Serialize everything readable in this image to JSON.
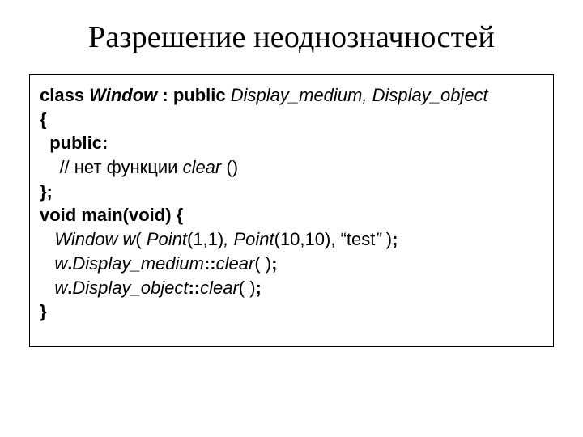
{
  "title": "Разрешение неоднозначностей",
  "code": {
    "l1a": "class ",
    "l1b": "Window",
    "l1c": " : public ",
    "l1d": "Display_medium, Display_object",
    "l2": "{",
    "l3": "  public:",
    "l4a": "    // нет функции ",
    "l4b": "clear",
    "l4c": " ()",
    "l5": "};",
    "l6": "void main(void) {",
    "l7a": "   Window w",
    "l7b": "( ",
    "l7c": "Point",
    "l7d": "(1,1)",
    "l7e": ", Point",
    "l7f": "(10,10), ",
    "l7g": "“",
    "l7h": "test",
    "l7i": "”",
    "l7j": " )",
    "l7k": ";",
    "l8a": "   w",
    "l8b": ".",
    "l8c": "Display_medium",
    "l8d": "::",
    "l8e": "clear",
    "l8f": "( )",
    "l8g": ";",
    "l9a": "   w",
    "l9b": ".",
    "l9c": "Display_object",
    "l9d": "::",
    "l9e": "clear",
    "l9f": "( )",
    "l9g": ";",
    "l10": "}"
  }
}
